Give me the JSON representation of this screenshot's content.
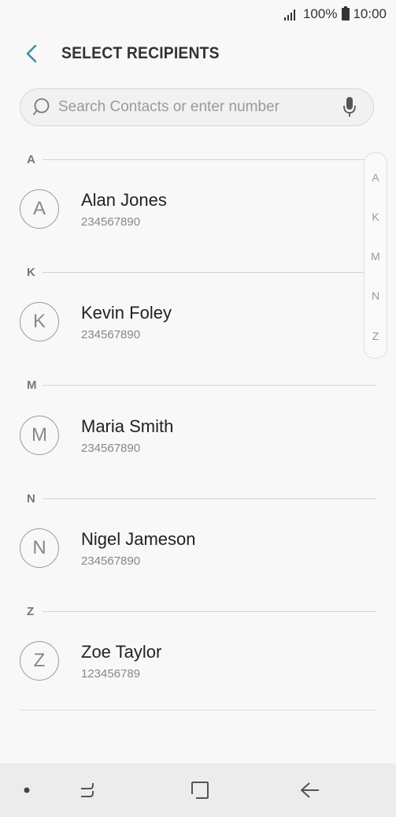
{
  "status_bar": {
    "signal_icon": "signal-icon",
    "battery_percent": "100%",
    "battery_icon": "battery-icon",
    "time": "10:00"
  },
  "header": {
    "back_icon": "back-icon",
    "title": "SELECT RECIPIENTS"
  },
  "search": {
    "placeholder": "Search Contacts or enter number",
    "value": "",
    "search_icon": "search-icon",
    "mic_icon": "microphone-icon"
  },
  "sections": [
    {
      "letter": "A",
      "contacts": [
        {
          "initial": "A",
          "name": "Alan Jones",
          "number": "234567890"
        }
      ]
    },
    {
      "letter": "K",
      "contacts": [
        {
          "initial": "K",
          "name": "Kevin Foley",
          "number": "234567890"
        }
      ]
    },
    {
      "letter": "M",
      "contacts": [
        {
          "initial": "M",
          "name": "Maria Smith",
          "number": "234567890"
        }
      ]
    },
    {
      "letter": "N",
      "contacts": [
        {
          "initial": "N",
          "name": "Nigel Jameson",
          "number": "234567890"
        }
      ]
    },
    {
      "letter": "Z",
      "contacts": [
        {
          "initial": "Z",
          "name": "Zoe Taylor",
          "number": "123456789"
        }
      ]
    }
  ],
  "index_bar": [
    "A",
    "K",
    "M",
    "N",
    "Z"
  ],
  "nav_bar": {
    "dot_icon": "dot-icon",
    "recents_icon": "recents-icon",
    "home_icon": "home-icon",
    "back_icon": "back-arrow-icon"
  },
  "colors": {
    "accent": "#3a8fa4",
    "background": "#f8f8f8",
    "nav_background": "#ececec"
  }
}
